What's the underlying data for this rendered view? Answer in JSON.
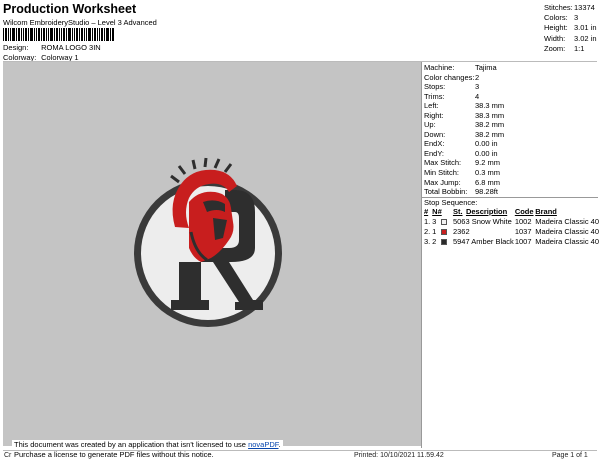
{
  "header": {
    "title": "Production Worksheet",
    "subtitle": "Wilcom EmbroideryStudio – Level 3 Advanced",
    "design_label": "Design:",
    "design_value": "ROMA LOGO 3IN",
    "colorway_label": "Colorway:",
    "colorway_value": "Colorway 1"
  },
  "stats": [
    {
      "label": "Stitches:",
      "value": "13374"
    },
    {
      "label": "Colors:",
      "value": "3"
    },
    {
      "label": "Height:",
      "value": "3.01 in"
    },
    {
      "label": "Width:",
      "value": "3.02 in"
    },
    {
      "label": "Zoom:",
      "value": "1:1"
    }
  ],
  "machine_info": [
    {
      "label": "Machine:",
      "value": "Tajima"
    },
    {
      "label": "Color changes:",
      "value": "2"
    },
    {
      "label": "Stops:",
      "value": "3"
    },
    {
      "label": "Trims:",
      "value": "4"
    },
    {
      "label": "Left:",
      "value": "38.3 mm"
    },
    {
      "label": "Right:",
      "value": "38.3 mm"
    },
    {
      "label": "Up:",
      "value": "38.2 mm"
    },
    {
      "label": "Down:",
      "value": "38.2 mm"
    },
    {
      "label": "EndX:",
      "value": "0.00 in"
    },
    {
      "label": "EndY:",
      "value": "0.00 in"
    },
    {
      "label": "Max Stitch:",
      "value": "9.2 mm"
    },
    {
      "label": "Min Stitch:",
      "value": "0.3 mm"
    },
    {
      "label": "Max Jump:",
      "value": "6.8 mm"
    },
    {
      "label": "Total Bobbin:",
      "value": "98.28ft"
    }
  ],
  "stop_sequence": {
    "title": "Stop Sequence:",
    "columns": [
      "#",
      "N#",
      "St.",
      "Description",
      "Code",
      "Brand"
    ],
    "rows": [
      {
        "index": "1.",
        "n": "3",
        "color": "#f2f2f2",
        "st": "5063",
        "description": "Snow White",
        "code": "1002",
        "brand": "Madeira Classic 40"
      },
      {
        "index": "2.",
        "n": "1",
        "color": "#c81e1e",
        "st": "2362",
        "description": "",
        "code": "1037",
        "brand": "Madeira Classic 40"
      },
      {
        "index": "3.",
        "n": "2",
        "color": "#2a2a2a",
        "st": "5947",
        "description": "Amber Black",
        "code": "1007",
        "brand": "Madeira Classic 40"
      }
    ]
  },
  "notice": {
    "line1_prefix": "This document was created by an application that isn't licensed to use ",
    "link": "novaPDF",
    "line1_suffix": ".",
    "line2": "Purchase a license to generate PDF files without this notice."
  },
  "footer": {
    "left": "Cr",
    "printed": "Printed: 10/10/2021 11.59.42",
    "page": "Page 1 of 1"
  },
  "colors": {
    "canvas_bg": "#c4c4c4",
    "patch_fill": "#ededed",
    "border": "#3a3a3a",
    "red": "#c81e1e",
    "black": "#2a2a2a"
  }
}
